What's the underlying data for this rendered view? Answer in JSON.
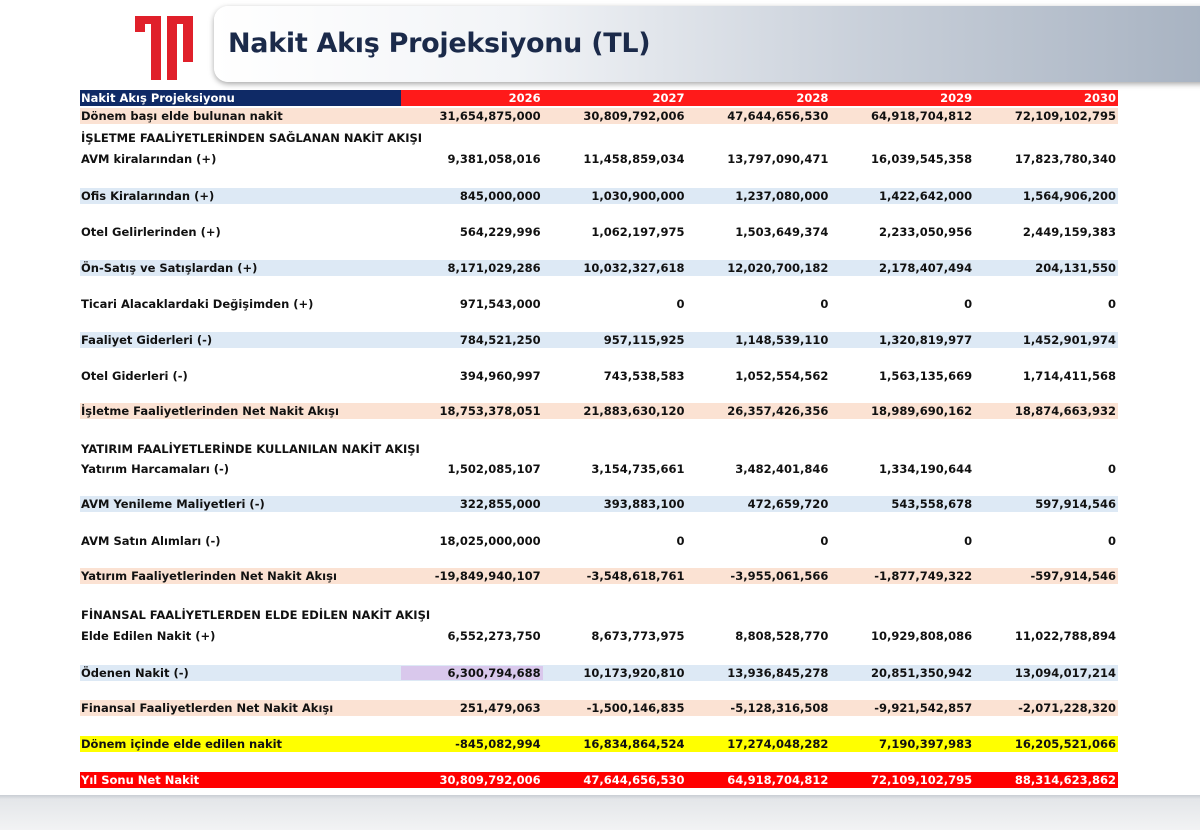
{
  "title": "Nakit Akış Projeksiyonu (TL)",
  "logo_name": "company-logo",
  "colors": {
    "header_navy": "#0f2a66",
    "header_red": "#ff1a1a",
    "row_blue": "#dde9f5",
    "row_peach": "#fbe2d3",
    "row_yellow": "#ffff00",
    "row_red": "#ff0000"
  },
  "table": {
    "header": {
      "label": "Nakit Akış Projeksiyonu",
      "years": [
        "2026",
        "2027",
        "2028",
        "2029",
        "2030"
      ]
    },
    "rows": [
      {
        "label": "Dönem başı elde bulunan nakit",
        "values": [
          "31,654,875,000",
          "30,809,792,006",
          "47,644,656,530",
          "64,918,704,812",
          "72,109,102,795"
        ]
      },
      {
        "label": "İŞLETME FAALİYETLERİNDEN SAĞLANAN NAKİT AKIŞI",
        "values": [
          "",
          "",
          "",
          "",
          ""
        ]
      },
      {
        "label": "AVM kiralarından (+)",
        "values": [
          "9,381,058,016",
          "11,458,859,034",
          "13,797,090,471",
          "16,039,545,358",
          "17,823,780,340"
        ]
      },
      {
        "label": "Ofis Kiralarından (+)",
        "values": [
          "845,000,000",
          "1,030,900,000",
          "1,237,080,000",
          "1,422,642,000",
          "1,564,906,200"
        ]
      },
      {
        "label": "Otel Gelirlerinden (+)",
        "values": [
          "564,229,996",
          "1,062,197,975",
          "1,503,649,374",
          "2,233,050,956",
          "2,449,159,383"
        ]
      },
      {
        "label": "Ön-Satış ve Satışlardan (+)",
        "values": [
          "8,171,029,286",
          "10,032,327,618",
          "12,020,700,182",
          "2,178,407,494",
          "204,131,550"
        ]
      },
      {
        "label": "Ticari Alacaklardaki Değişimden (+)",
        "values": [
          "971,543,000",
          "0",
          "0",
          "0",
          "0"
        ]
      },
      {
        "label": "Faaliyet Giderleri (-)",
        "values": [
          "784,521,250",
          "957,115,925",
          "1,148,539,110",
          "1,320,819,977",
          "1,452,901,974"
        ]
      },
      {
        "label": "Otel Giderleri (-)",
        "values": [
          "394,960,997",
          "743,538,583",
          "1,052,554,562",
          "1,563,135,669",
          "1,714,411,568"
        ]
      },
      {
        "label": "İşletme Faaliyetlerinden Net Nakit Akışı",
        "values": [
          "18,753,378,051",
          "21,883,630,120",
          "26,357,426,356",
          "18,989,690,162",
          "18,874,663,932"
        ]
      },
      {
        "label": "YATIRIM FAALİYETLERİNDE KULLANILAN NAKİT AKIŞI",
        "values": [
          "",
          "",
          "",
          "",
          ""
        ]
      },
      {
        "label": "Yatırım Harcamaları (-)",
        "values": [
          "1,502,085,107",
          "3,154,735,661",
          "3,482,401,846",
          "1,334,190,644",
          "0"
        ]
      },
      {
        "label": "AVM Yenileme Maliyetleri (-)",
        "values": [
          "322,855,000",
          "393,883,100",
          "472,659,720",
          "543,558,678",
          "597,914,546"
        ]
      },
      {
        "label": "AVM Satın Alımları (-)",
        "values": [
          "18,025,000,000",
          "0",
          "0",
          "0",
          "0"
        ]
      },
      {
        "label": "Yatırım Faaliyetlerinden Net Nakit Akışı",
        "values": [
          "-19,849,940,107",
          "-3,548,618,761",
          "-3,955,061,566",
          "-1,877,749,322",
          "-597,914,546"
        ]
      },
      {
        "label": "FİNANSAL FAALİYETLERDEN ELDE EDİLEN NAKİT AKIŞI",
        "values": [
          "",
          "",
          "",
          "",
          ""
        ]
      },
      {
        "label": "Elde Edilen Nakit (+)",
        "values": [
          "6,552,273,750",
          "8,673,773,975",
          "8,808,528,770",
          "10,929,808,086",
          "11,022,788,894"
        ]
      },
      {
        "label": "Ödenen Nakit (-)",
        "values": [
          "6,300,794,688",
          "10,173,920,810",
          "13,936,845,278",
          "20,851,350,942",
          "13,094,017,214"
        ]
      },
      {
        "label": "Finansal Faaliyetlerden Net Nakit Akışı",
        "values": [
          "251,479,063",
          "-1,500,146,835",
          "-5,128,316,508",
          "-9,921,542,857",
          "-2,071,228,320"
        ]
      },
      {
        "label": "Dönem içinde elde edilen nakit",
        "values": [
          "-845,082,994",
          "16,834,864,524",
          "17,274,048,282",
          "7,190,397,983",
          "16,205,521,066"
        ]
      },
      {
        "label": "Yıl Sonu Net Nakit",
        "values": [
          "30,809,792,006",
          "47,644,656,530",
          "64,918,704,812",
          "72,109,102,795",
          "88,314,623,862"
        ]
      }
    ]
  }
}
